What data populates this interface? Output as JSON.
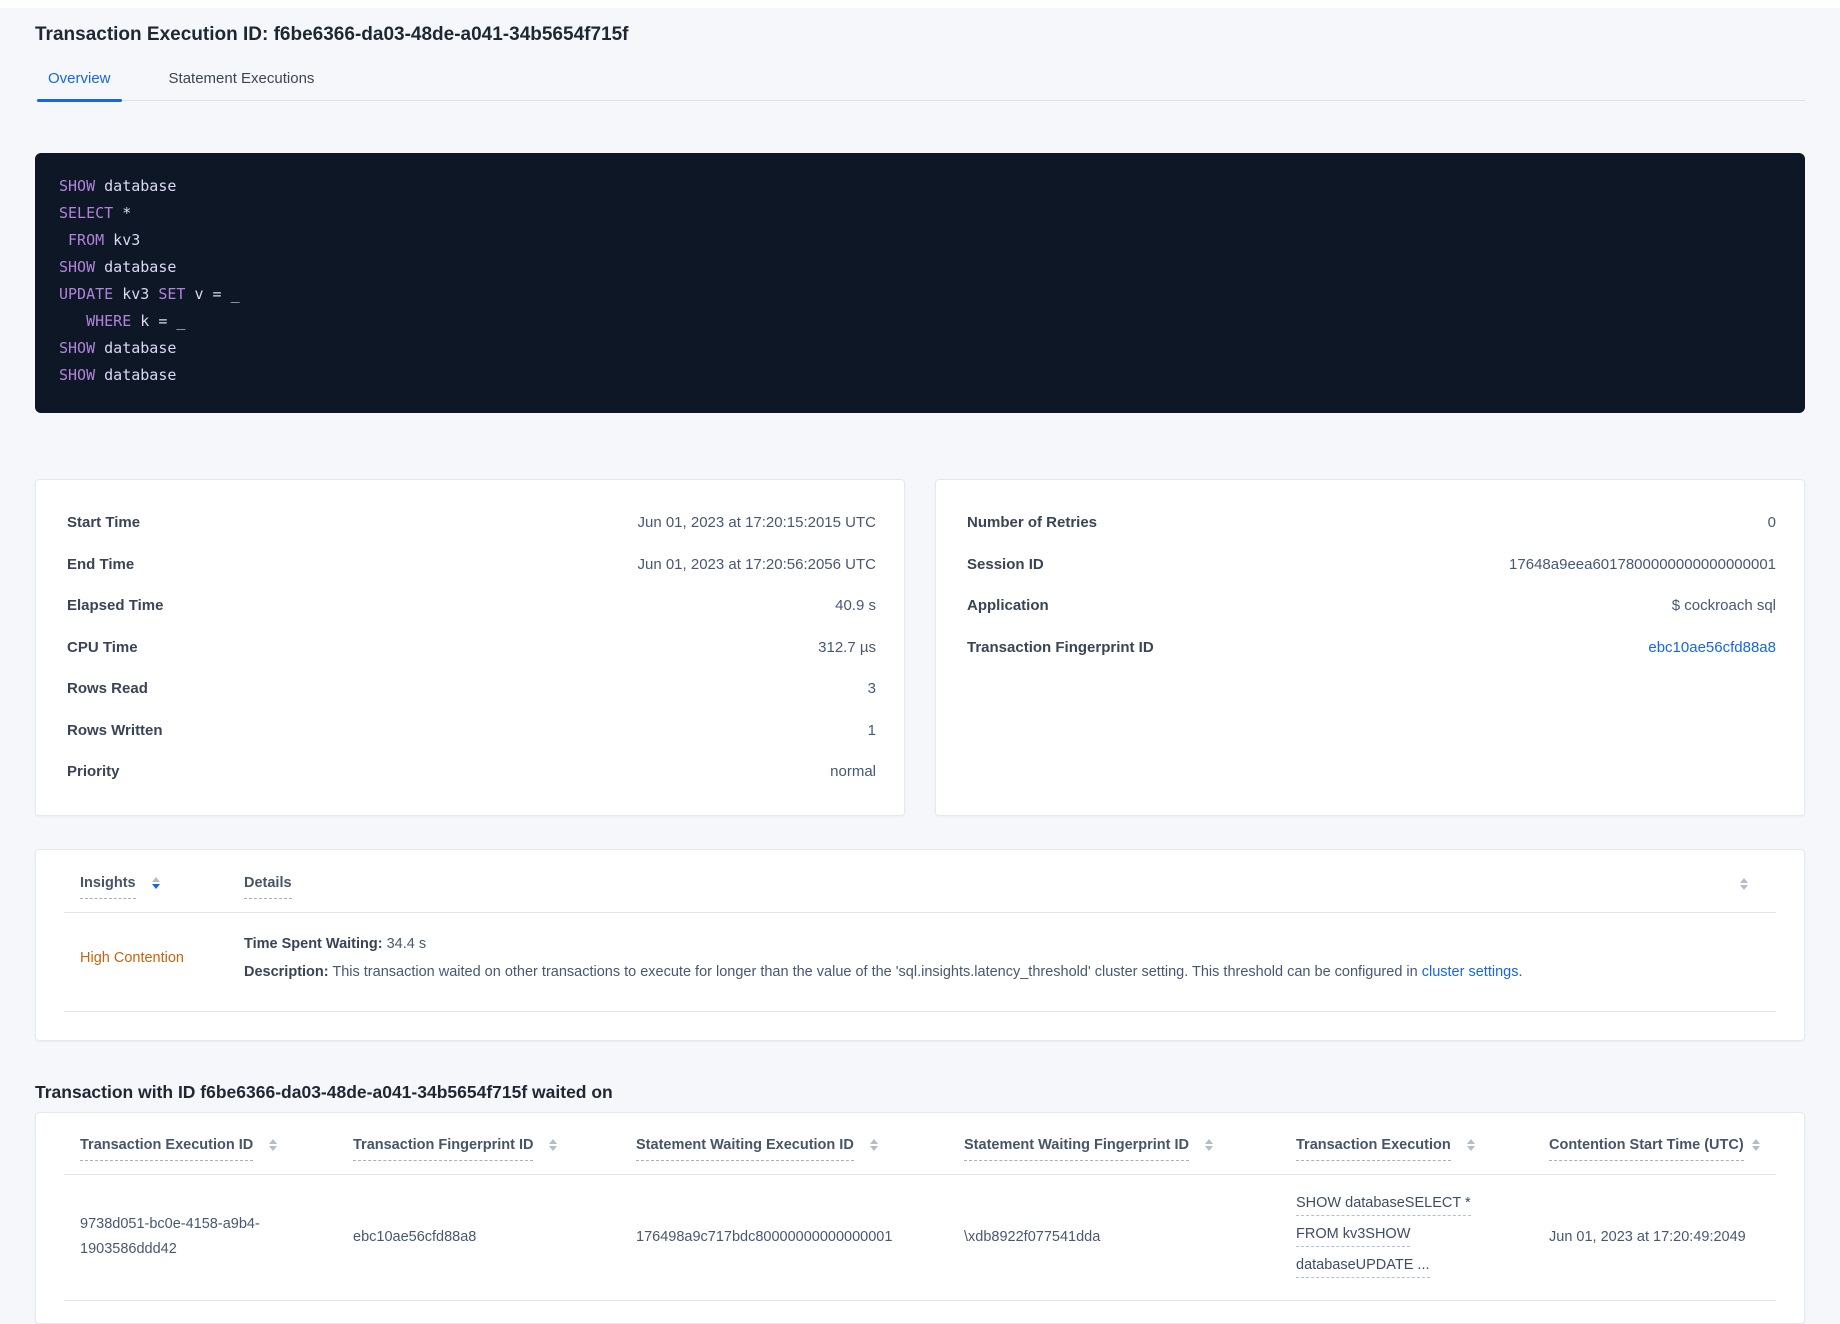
{
  "page": {
    "title": "Transaction Execution ID: f6be6366-da03-48de-a041-34b5654f715f"
  },
  "colors": {
    "accent_blue": "#1666e8",
    "insight_orange": "#c4650e",
    "code_background": "#0e1726",
    "code_keyword": "#b184db",
    "code_plain": "#dbd9f4",
    "page_background": "#f5f7fa"
  },
  "tabs": [
    {
      "label": "Overview",
      "active": true
    },
    {
      "label": "Statement Executions",
      "active": false
    }
  ],
  "sql": {
    "lines": [
      {
        "tokens": [
          {
            "text": "SHOW"
          },
          {
            "text": " database"
          }
        ]
      },
      {
        "tokens": [
          {
            "text": "SELECT"
          },
          {
            "text": " *"
          }
        ]
      },
      {
        "tokens": [
          {
            "text": " "
          },
          {
            "text": "FROM"
          },
          {
            "text": " kv3"
          }
        ]
      },
      {
        "tokens": [
          {
            "text": "SHOW"
          },
          {
            "text": " database"
          }
        ]
      },
      {
        "tokens": [
          {
            "text": "UPDATE"
          },
          {
            "text": " kv3 "
          },
          {
            "text": "SET"
          },
          {
            "text": " v = _"
          }
        ]
      },
      {
        "tokens": [
          {
            "text": "   "
          },
          {
            "text": "WHERE"
          },
          {
            "text": " k = _"
          }
        ]
      },
      {
        "tokens": [
          {
            "text": "SHOW"
          },
          {
            "text": " database"
          }
        ]
      },
      {
        "tokens": [
          {
            "text": "SHOW"
          },
          {
            "text": " database"
          }
        ]
      }
    ]
  },
  "summary_left": {
    "rows": [
      {
        "label": "Start Time",
        "value": "Jun 01, 2023 at 17:20:15:2015 UTC"
      },
      {
        "label": "End Time",
        "value": "Jun 01, 2023 at 17:20:56:2056 UTC"
      },
      {
        "label": "Elapsed Time",
        "value": "40.9 s"
      },
      {
        "label": "CPU Time",
        "value": "312.7 µs"
      },
      {
        "label": "Rows Read",
        "value": "3"
      },
      {
        "label": "Rows Written",
        "value": "1"
      },
      {
        "label": "Priority",
        "value": "normal"
      }
    ]
  },
  "summary_right": {
    "rows": [
      {
        "label": "Number of Retries",
        "value": "0"
      },
      {
        "label": "Session ID",
        "value": "17648a9eea6017800000000000000001"
      },
      {
        "label": "Application",
        "value": "$ cockroach sql"
      },
      {
        "label": "Transaction Fingerprint ID",
        "value": "ebc10ae56cfd88a8"
      }
    ]
  },
  "insights_table": {
    "columns": [
      "Insights",
      "Details"
    ],
    "row": {
      "insight": "High Contention",
      "waiting_label": "Time Spent Waiting:",
      "waiting_value": " 34.4 s",
      "desc_label": "Description:",
      "desc_text": " This transaction waited on other transactions to execute for longer than the value of the 'sql.insights.latency_threshold' cluster setting. This threshold can be configured in ",
      "desc_link": "cluster settings",
      "desc_suffix": "."
    }
  },
  "waited_on": {
    "heading": "Transaction with ID f6be6366-da03-48de-a041-34b5654f715f waited on",
    "columns": [
      "Transaction Execution ID",
      "Transaction Fingerprint ID",
      "Statement Waiting Execution ID",
      "Statement Waiting Fingerprint ID",
      "Transaction Execution",
      "Contention Start Time (UTC)"
    ],
    "row": {
      "txn_execution_id": "9738d051-bc0e-4158-a9b4-1903586ddd42",
      "txn_fingerprint_id": "ebc10ae56cfd88a8",
      "stmt_waiting_execution_id": "176498a9c717bdc80000000000000001",
      "stmt_waiting_fingerprint_id": "\\xdb8922f077541dda",
      "txn_execution_lines": [
        "SHOW databaseSELECT *",
        "FROM kv3SHOW",
        "databaseUPDATE ..."
      ],
      "contention_start_time": "Jun 01, 2023 at 17:20:49:2049"
    }
  }
}
